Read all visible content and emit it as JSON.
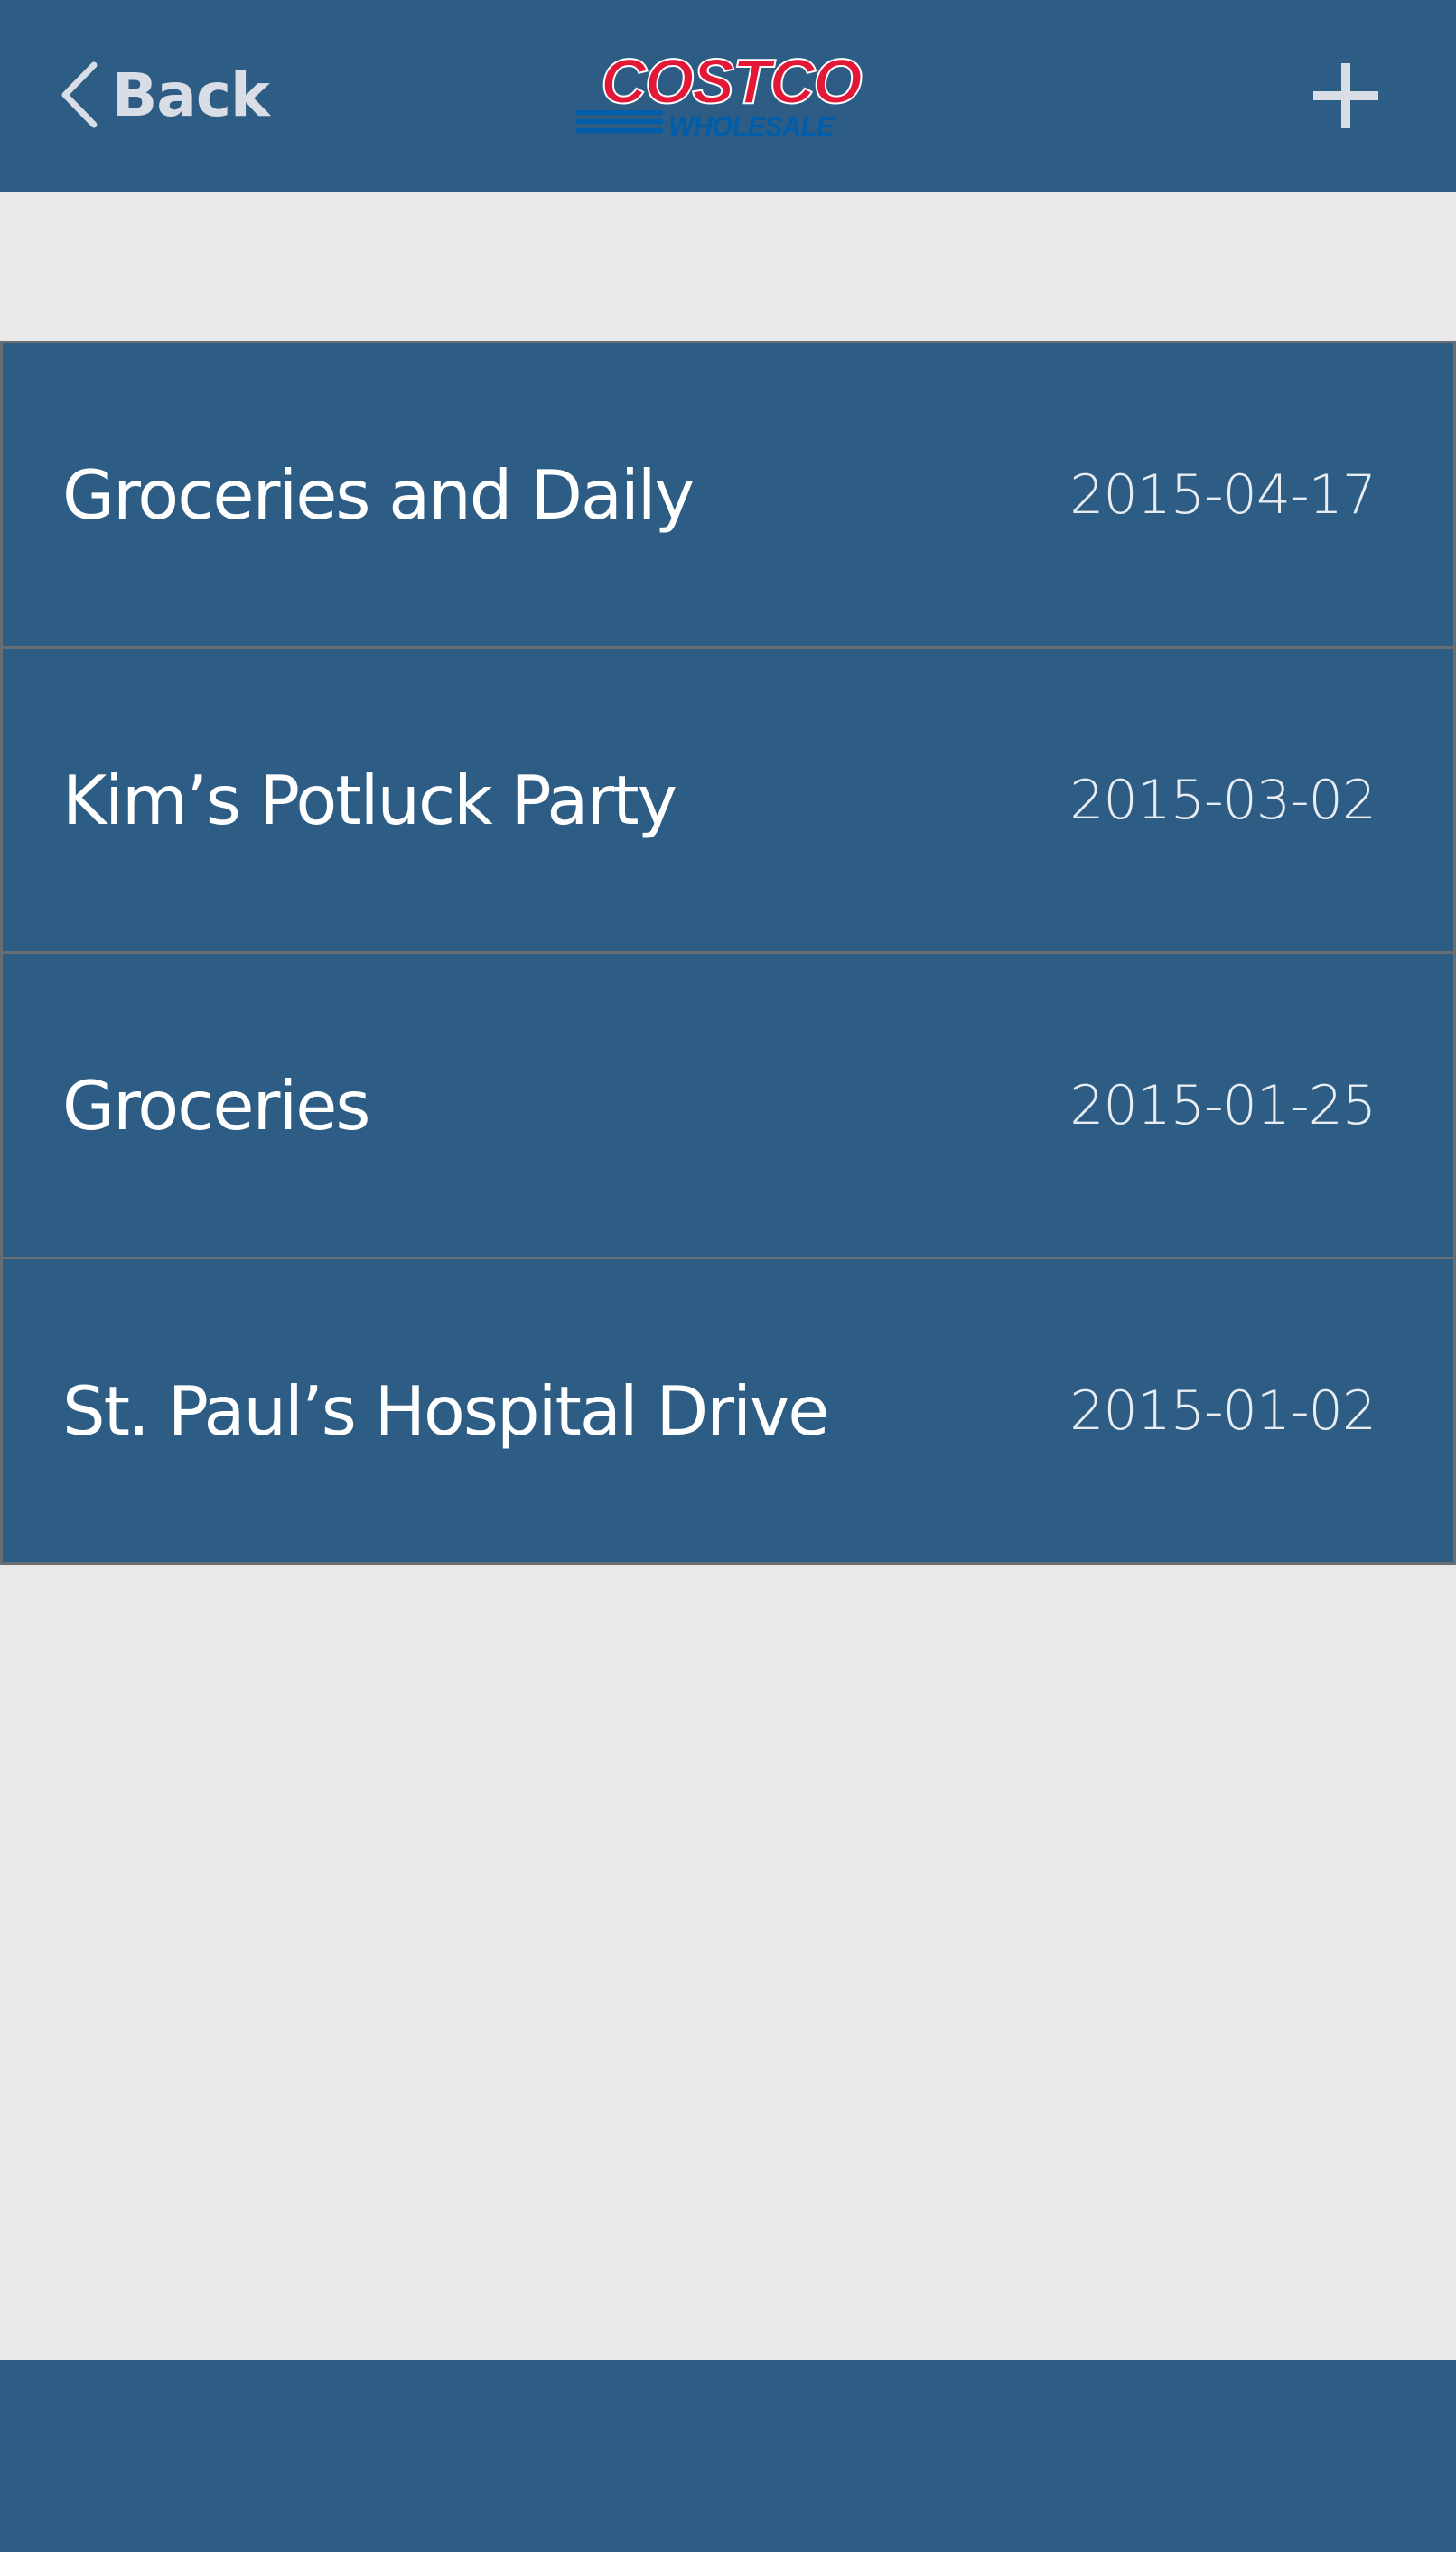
{
  "header": {
    "back_label": "Back",
    "logo": {
      "top_text": "COSTCO",
      "bottom_text": "WHOLESALE",
      "colors": {
        "red": "#e31837",
        "blue": "#005daa"
      }
    },
    "add_icon": "plus-icon",
    "back_icon": "chevron-left-icon"
  },
  "lists": [
    {
      "title": "Groceries and Daily",
      "date": "2015-04-17"
    },
    {
      "title": "Kim’s Potluck Party",
      "date": "2015-03-02"
    },
    {
      "title": "Groceries",
      "date": "2015-01-25"
    },
    {
      "title": "St. Paul’s Hospital Drive",
      "date": "2015-01-02"
    }
  ],
  "colors": {
    "bar": "#2d5d84",
    "background": "#e8e9e8",
    "divider": "#6a6e72",
    "text": "#ffffff"
  }
}
